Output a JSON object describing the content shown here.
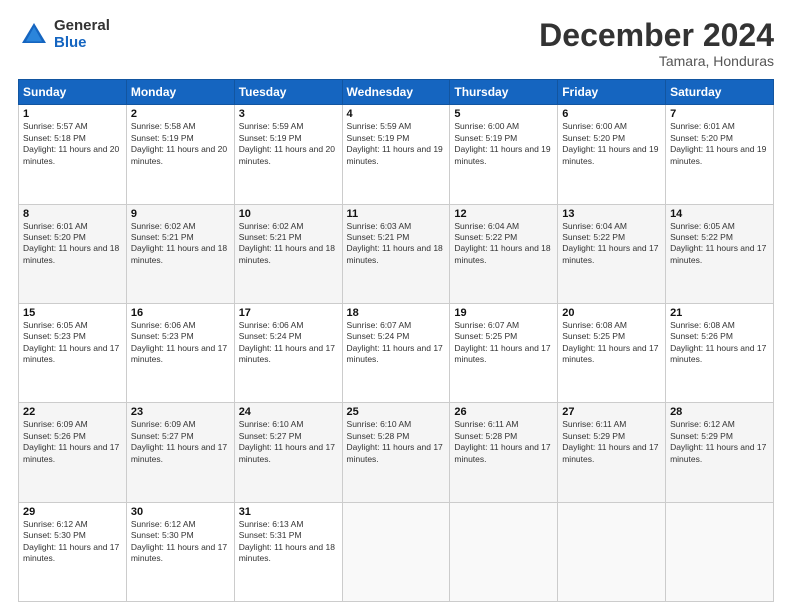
{
  "header": {
    "logo_general": "General",
    "logo_blue": "Blue",
    "month_title": "December 2024",
    "subtitle": "Tamara, Honduras"
  },
  "days_of_week": [
    "Sunday",
    "Monday",
    "Tuesday",
    "Wednesday",
    "Thursday",
    "Friday",
    "Saturday"
  ],
  "weeks": [
    [
      {
        "day": "1",
        "sunrise": "5:57 AM",
        "sunset": "5:18 PM",
        "daylight": "11 hours and 20 minutes."
      },
      {
        "day": "2",
        "sunrise": "5:58 AM",
        "sunset": "5:19 PM",
        "daylight": "11 hours and 20 minutes."
      },
      {
        "day": "3",
        "sunrise": "5:59 AM",
        "sunset": "5:19 PM",
        "daylight": "11 hours and 20 minutes."
      },
      {
        "day": "4",
        "sunrise": "5:59 AM",
        "sunset": "5:19 PM",
        "daylight": "11 hours and 19 minutes."
      },
      {
        "day": "5",
        "sunrise": "6:00 AM",
        "sunset": "5:19 PM",
        "daylight": "11 hours and 19 minutes."
      },
      {
        "day": "6",
        "sunrise": "6:00 AM",
        "sunset": "5:20 PM",
        "daylight": "11 hours and 19 minutes."
      },
      {
        "day": "7",
        "sunrise": "6:01 AM",
        "sunset": "5:20 PM",
        "daylight": "11 hours and 19 minutes."
      }
    ],
    [
      {
        "day": "8",
        "sunrise": "6:01 AM",
        "sunset": "5:20 PM",
        "daylight": "11 hours and 18 minutes."
      },
      {
        "day": "9",
        "sunrise": "6:02 AM",
        "sunset": "5:21 PM",
        "daylight": "11 hours and 18 minutes."
      },
      {
        "day": "10",
        "sunrise": "6:02 AM",
        "sunset": "5:21 PM",
        "daylight": "11 hours and 18 minutes."
      },
      {
        "day": "11",
        "sunrise": "6:03 AM",
        "sunset": "5:21 PM",
        "daylight": "11 hours and 18 minutes."
      },
      {
        "day": "12",
        "sunrise": "6:04 AM",
        "sunset": "5:22 PM",
        "daylight": "11 hours and 18 minutes."
      },
      {
        "day": "13",
        "sunrise": "6:04 AM",
        "sunset": "5:22 PM",
        "daylight": "11 hours and 17 minutes."
      },
      {
        "day": "14",
        "sunrise": "6:05 AM",
        "sunset": "5:22 PM",
        "daylight": "11 hours and 17 minutes."
      }
    ],
    [
      {
        "day": "15",
        "sunrise": "6:05 AM",
        "sunset": "5:23 PM",
        "daylight": "11 hours and 17 minutes."
      },
      {
        "day": "16",
        "sunrise": "6:06 AM",
        "sunset": "5:23 PM",
        "daylight": "11 hours and 17 minutes."
      },
      {
        "day": "17",
        "sunrise": "6:06 AM",
        "sunset": "5:24 PM",
        "daylight": "11 hours and 17 minutes."
      },
      {
        "day": "18",
        "sunrise": "6:07 AM",
        "sunset": "5:24 PM",
        "daylight": "11 hours and 17 minutes."
      },
      {
        "day": "19",
        "sunrise": "6:07 AM",
        "sunset": "5:25 PM",
        "daylight": "11 hours and 17 minutes."
      },
      {
        "day": "20",
        "sunrise": "6:08 AM",
        "sunset": "5:25 PM",
        "daylight": "11 hours and 17 minutes."
      },
      {
        "day": "21",
        "sunrise": "6:08 AM",
        "sunset": "5:26 PM",
        "daylight": "11 hours and 17 minutes."
      }
    ],
    [
      {
        "day": "22",
        "sunrise": "6:09 AM",
        "sunset": "5:26 PM",
        "daylight": "11 hours and 17 minutes."
      },
      {
        "day": "23",
        "sunrise": "6:09 AM",
        "sunset": "5:27 PM",
        "daylight": "11 hours and 17 minutes."
      },
      {
        "day": "24",
        "sunrise": "6:10 AM",
        "sunset": "5:27 PM",
        "daylight": "11 hours and 17 minutes."
      },
      {
        "day": "25",
        "sunrise": "6:10 AM",
        "sunset": "5:28 PM",
        "daylight": "11 hours and 17 minutes."
      },
      {
        "day": "26",
        "sunrise": "6:11 AM",
        "sunset": "5:28 PM",
        "daylight": "11 hours and 17 minutes."
      },
      {
        "day": "27",
        "sunrise": "6:11 AM",
        "sunset": "5:29 PM",
        "daylight": "11 hours and 17 minutes."
      },
      {
        "day": "28",
        "sunrise": "6:12 AM",
        "sunset": "5:29 PM",
        "daylight": "11 hours and 17 minutes."
      }
    ],
    [
      {
        "day": "29",
        "sunrise": "6:12 AM",
        "sunset": "5:30 PM",
        "daylight": "11 hours and 17 minutes."
      },
      {
        "day": "30",
        "sunrise": "6:12 AM",
        "sunset": "5:30 PM",
        "daylight": "11 hours and 17 minutes."
      },
      {
        "day": "31",
        "sunrise": "6:13 AM",
        "sunset": "5:31 PM",
        "daylight": "11 hours and 18 minutes."
      },
      null,
      null,
      null,
      null
    ]
  ]
}
